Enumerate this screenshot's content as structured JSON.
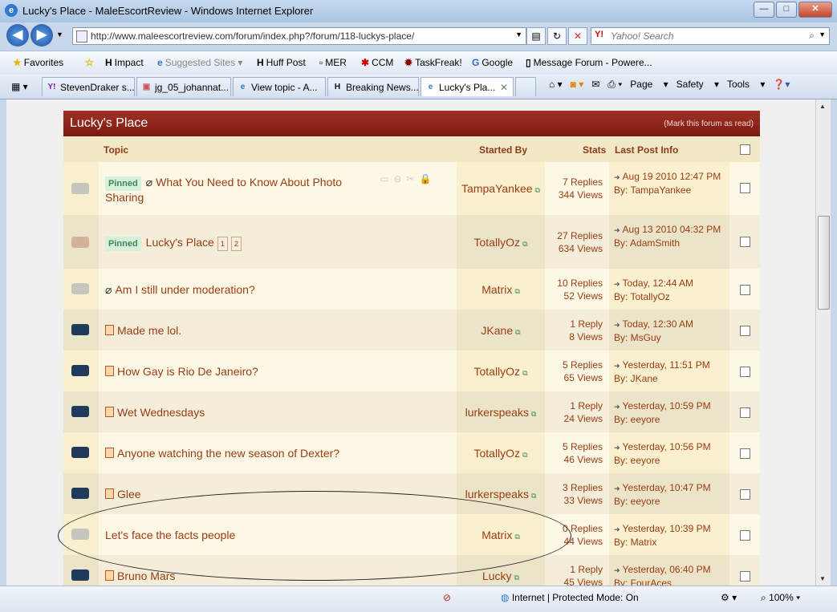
{
  "window": {
    "title": "Lucky's Place - MaleEscortReview - Windows Internet Explorer"
  },
  "address": {
    "url": "http://www.maleescortreview.com/forum/index.php?/forum/118-luckys-place/"
  },
  "search": {
    "placeholder": "Yahoo! Search"
  },
  "favorites": {
    "label": "Favorites",
    "items": [
      "Impact",
      "Suggested Sites",
      "Huff Post",
      "MER",
      "CCM",
      "TaskFreak!",
      "Google",
      "Message Forum - Powere..."
    ]
  },
  "tabs": [
    {
      "label": "StevenDraker s..."
    },
    {
      "label": "jg_05_johannat..."
    },
    {
      "label": "View topic - A..."
    },
    {
      "label": "Breaking News..."
    },
    {
      "label": "Lucky's Pla..."
    }
  ],
  "commands": {
    "page": "Page",
    "safety": "Safety",
    "tools": "Tools"
  },
  "forum": {
    "name": "Lucky's Place",
    "mark_read": "(Mark this forum as read)",
    "columns": {
      "topic": "Topic",
      "started_by": "Started By",
      "stats": "Stats",
      "last_post": "Last Post Info"
    },
    "pinned_label": "Pinned",
    "rows": [
      {
        "title": "What You Need to Know About Photo Sharing",
        "starter": "TampaYankee",
        "replies": "7 Replies",
        "views": "344 Views",
        "last_date": "Aug 19 2010 12:47 PM",
        "last_by": "By: TampaYankee"
      },
      {
        "title": "Lucky's Place",
        "page1": "1",
        "page2": "2",
        "starter": "TotallyOz",
        "replies": "27 Replies",
        "views": "634 Views",
        "last_date": "Aug 13 2010 04:32 PM",
        "last_by": "By: AdamSmith"
      },
      {
        "title": "Am I still under moderation?",
        "starter": "Matrix",
        "replies": "10 Replies",
        "views": "52 Views",
        "last_date": "Today, 12:44 AM",
        "last_by": "By: TotallyOz"
      },
      {
        "title": "Made me lol.",
        "starter": "JKane",
        "replies": "1 Reply",
        "views": "8 Views",
        "last_date": "Today, 12:30 AM",
        "last_by": "By: MsGuy"
      },
      {
        "title": "How Gay is Rio De Janeiro?",
        "starter": "TotallyOz",
        "replies": "5 Replies",
        "views": "65 Views",
        "last_date": "Yesterday, 11:51 PM",
        "last_by": "By: JKane"
      },
      {
        "title": "Wet Wednesdays",
        "starter": "lurkerspeaks",
        "replies": "1 Reply",
        "views": "24 Views",
        "last_date": "Yesterday, 10:59 PM",
        "last_by": "By: eeyore"
      },
      {
        "title": "Anyone watching the new season of Dexter?",
        "starter": "TotallyOz",
        "replies": "5 Replies",
        "views": "46 Views",
        "last_date": "Yesterday, 10:56 PM",
        "last_by": "By: eeyore"
      },
      {
        "title": "Glee",
        "starter": "lurkerspeaks",
        "replies": "3 Replies",
        "views": "33 Views",
        "last_date": "Yesterday, 10:47 PM",
        "last_by": "By: eeyore"
      },
      {
        "title": "Let's face the facts people",
        "starter": "Matrix",
        "replies": "0 Replies",
        "views": "44 Views",
        "last_date": "Yesterday, 10:39 PM",
        "last_by": "By: Matrix"
      },
      {
        "title": "Bruno Mars",
        "starter": "Lucky",
        "replies": "1 Reply",
        "views": "45 Views",
        "last_date": "Yesterday, 06:40 PM",
        "last_by": "By: FourAces"
      }
    ]
  },
  "status": {
    "zone": "Internet | Protected Mode: On",
    "zoom": "100%"
  }
}
